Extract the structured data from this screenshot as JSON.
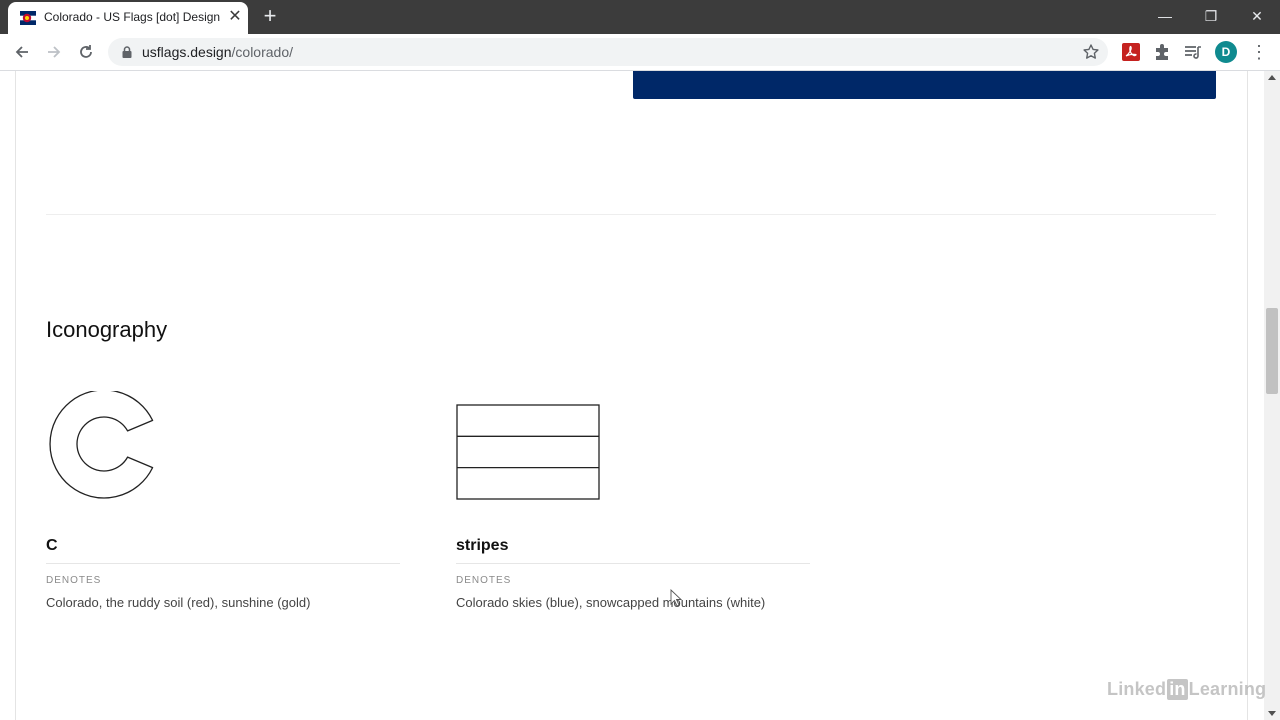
{
  "browser": {
    "tab_title": "Colorado - US Flags [dot] Design",
    "url_host": "usflags.design",
    "url_path": "/colorado/",
    "avatar_letter": "D",
    "accent": "#0f8a8f"
  },
  "page": {
    "section_title": "Iconography",
    "flag_color": "#002868",
    "icons": [
      {
        "name": "C",
        "meta_label": "DENOTES",
        "meta_value": "Colorado, the ruddy soil (red), sunshine (gold)"
      },
      {
        "name": "stripes",
        "meta_label": "DENOTES",
        "meta_value": "Colorado skies (blue), snowcapped mountains (white)"
      }
    ]
  },
  "watermark": {
    "prefix": "Linked",
    "box": "in",
    "suffix": "Learning"
  }
}
